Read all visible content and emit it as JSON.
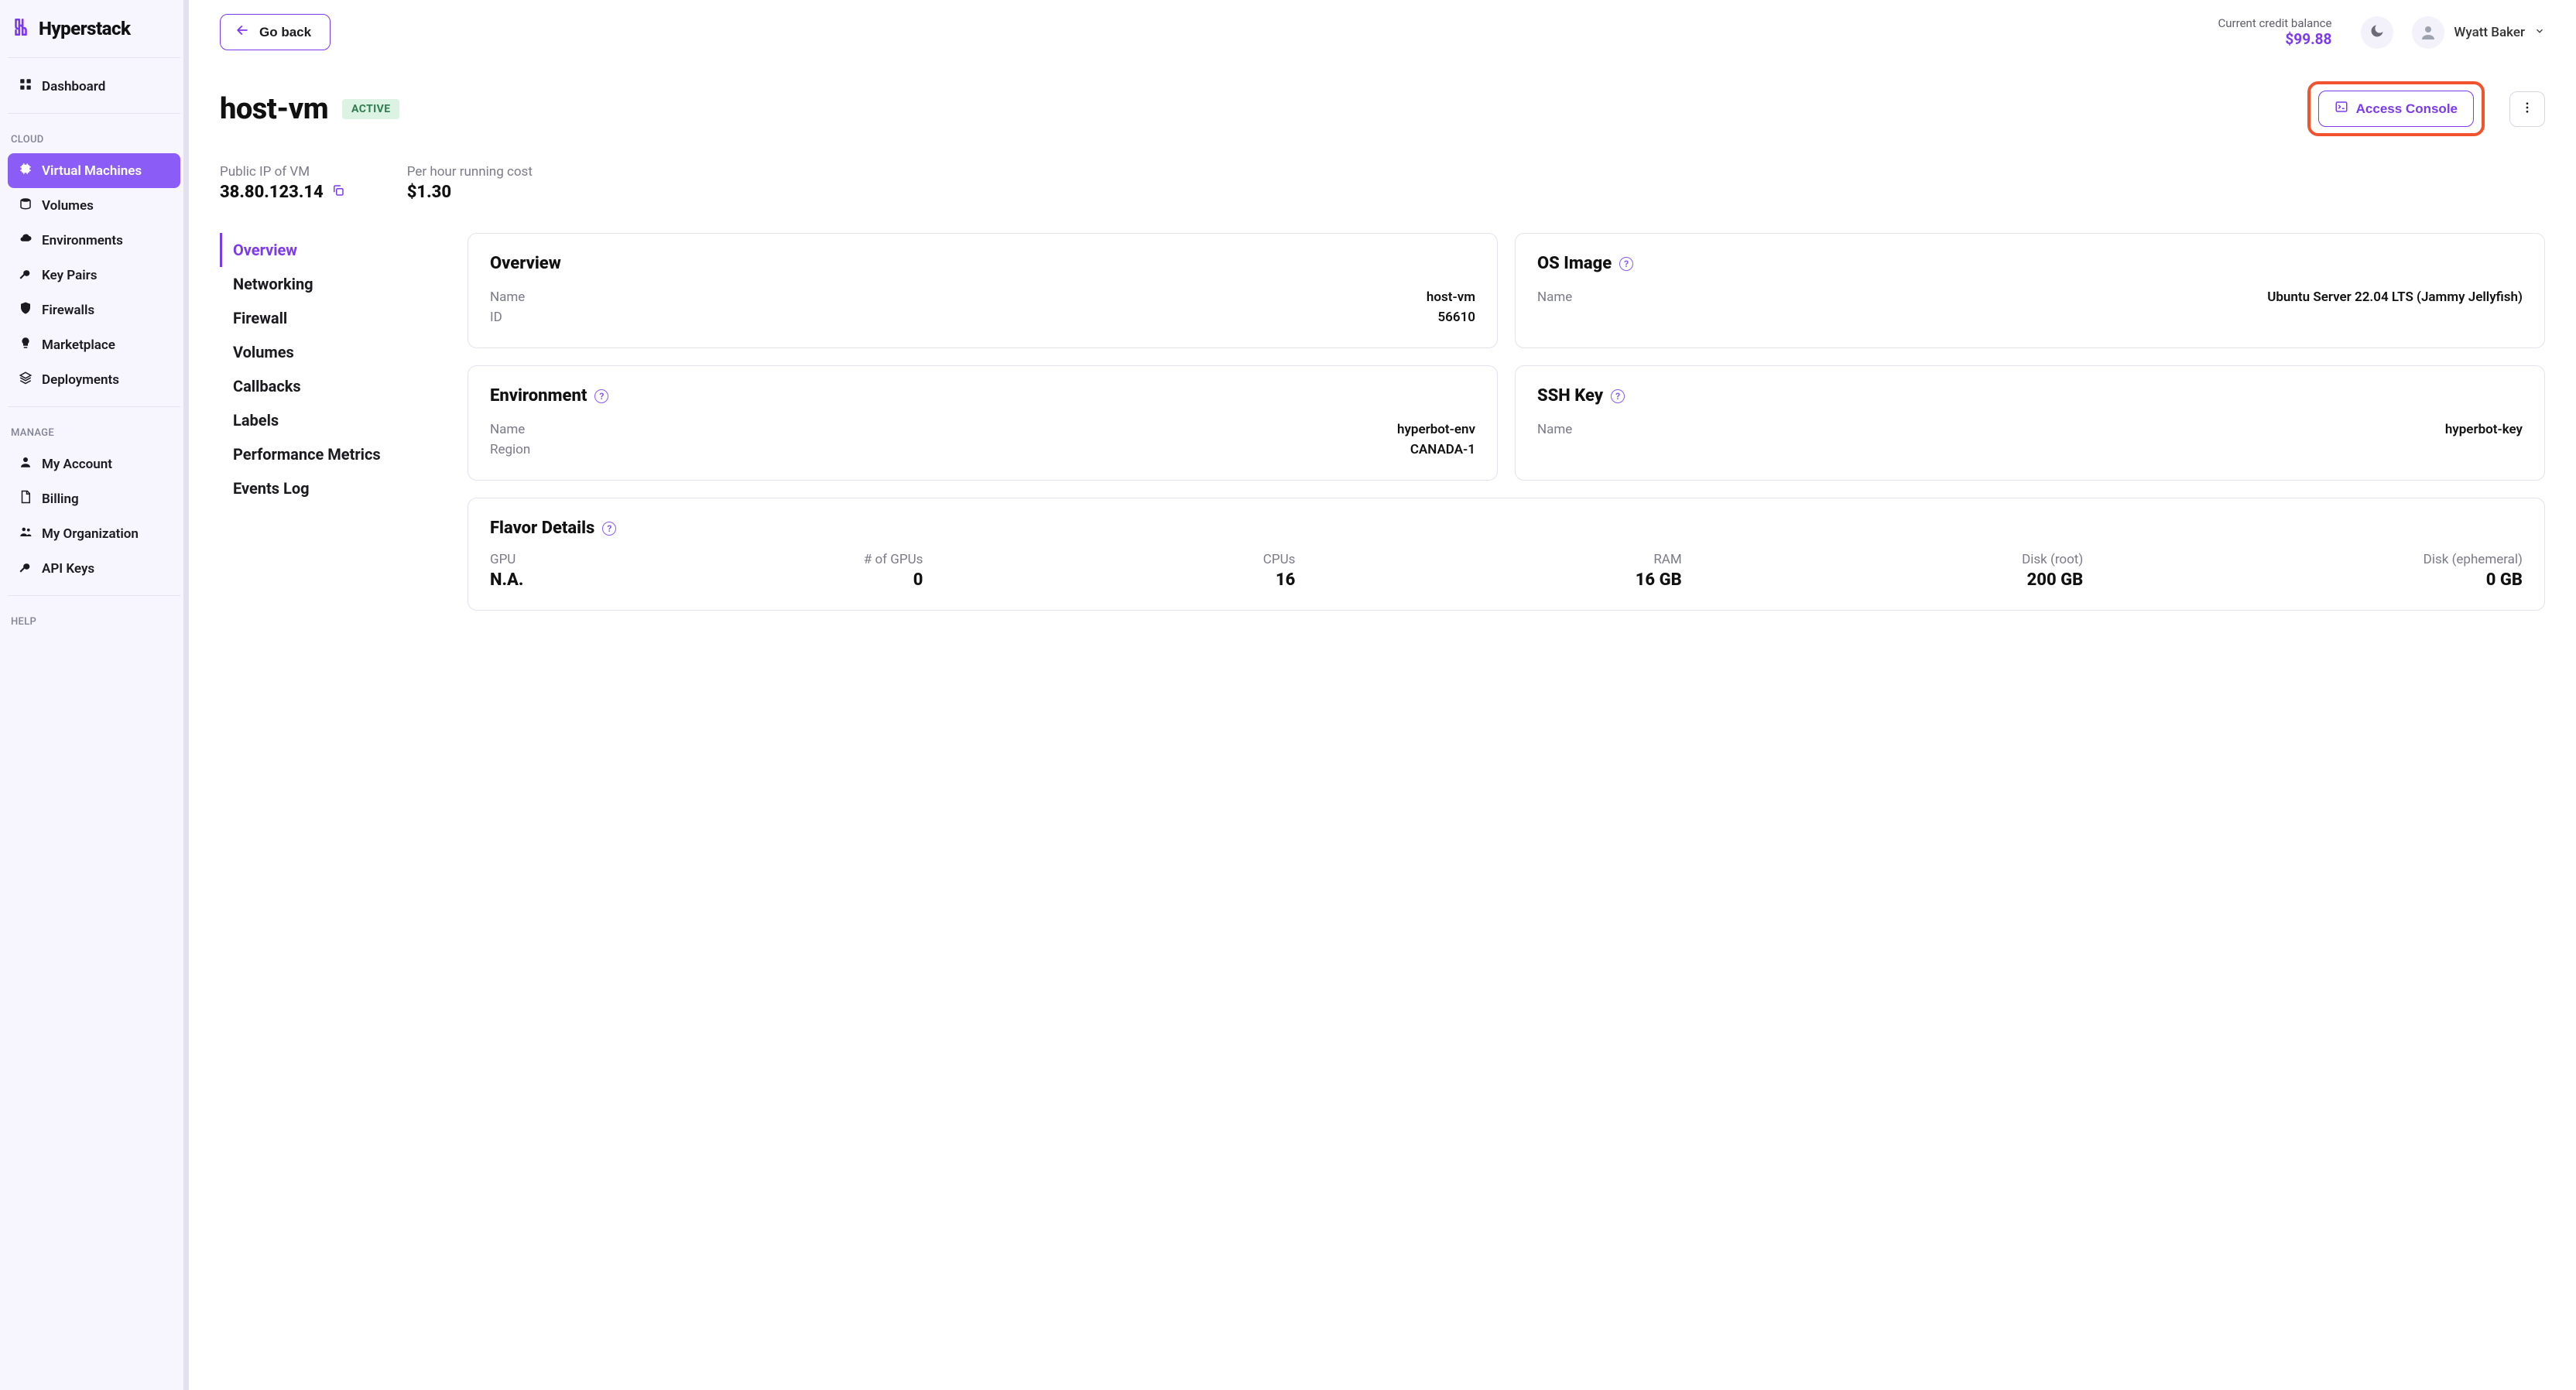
{
  "brand": {
    "name": "Hyperstack"
  },
  "sidebar": {
    "items": [
      {
        "label": "Dashboard",
        "icon": "grid"
      },
      {
        "label": "Virtual Machines",
        "icon": "chip",
        "active": true
      },
      {
        "label": "Volumes",
        "icon": "disk"
      },
      {
        "label": "Environments",
        "icon": "cloud"
      },
      {
        "label": "Key Pairs",
        "icon": "key"
      },
      {
        "label": "Firewalls",
        "icon": "shield"
      },
      {
        "label": "Marketplace",
        "icon": "bulb"
      },
      {
        "label": "Deployments",
        "icon": "layers"
      }
    ],
    "section_labels": {
      "cloud": "CLOUD",
      "manage": "MANAGE",
      "help": "HELP"
    },
    "manage_items": [
      {
        "label": "My Account",
        "icon": "user"
      },
      {
        "label": "Billing",
        "icon": "file"
      },
      {
        "label": "My Organization",
        "icon": "users"
      },
      {
        "label": "API Keys",
        "icon": "key"
      }
    ]
  },
  "topbar": {
    "go_back_label": "Go back",
    "balance_label": "Current credit balance",
    "balance_value": "$99.88",
    "user_name": "Wyatt Baker"
  },
  "vm": {
    "name": "host-vm",
    "status": "ACTIVE",
    "access_console_label": "Access Console",
    "public_ip_label": "Public IP of VM",
    "public_ip": "38.80.123.14",
    "cost_label": "Per hour running cost",
    "cost": "$1.30"
  },
  "section_nav": [
    "Overview",
    "Networking",
    "Firewall",
    "Volumes",
    "Callbacks",
    "Labels",
    "Performance Metrics",
    "Events Log"
  ],
  "cards": {
    "overview": {
      "title": "Overview",
      "name_label": "Name",
      "name_value": "host-vm",
      "id_label": "ID",
      "id_value": "56610"
    },
    "os": {
      "title": "OS Image",
      "name_label": "Name",
      "name_value": "Ubuntu Server 22.04 LTS (Jammy Jellyfish)"
    },
    "env": {
      "title": "Environment",
      "name_label": "Name",
      "name_value": "hyperbot-env",
      "region_label": "Region",
      "region_value": "CANADA-1"
    },
    "ssh": {
      "title": "SSH Key",
      "name_label": "Name",
      "name_value": "hyperbot-key"
    },
    "flavor": {
      "title": "Flavor Details",
      "cells": [
        {
          "label": "GPU",
          "value": "N.A."
        },
        {
          "label": "# of GPUs",
          "value": "0"
        },
        {
          "label": "CPUs",
          "value": "16"
        },
        {
          "label": "RAM",
          "value": "16 GB"
        },
        {
          "label": "Disk (root)",
          "value": "200 GB"
        },
        {
          "label": "Disk (ephemeral)",
          "value": "0 GB"
        }
      ]
    }
  }
}
